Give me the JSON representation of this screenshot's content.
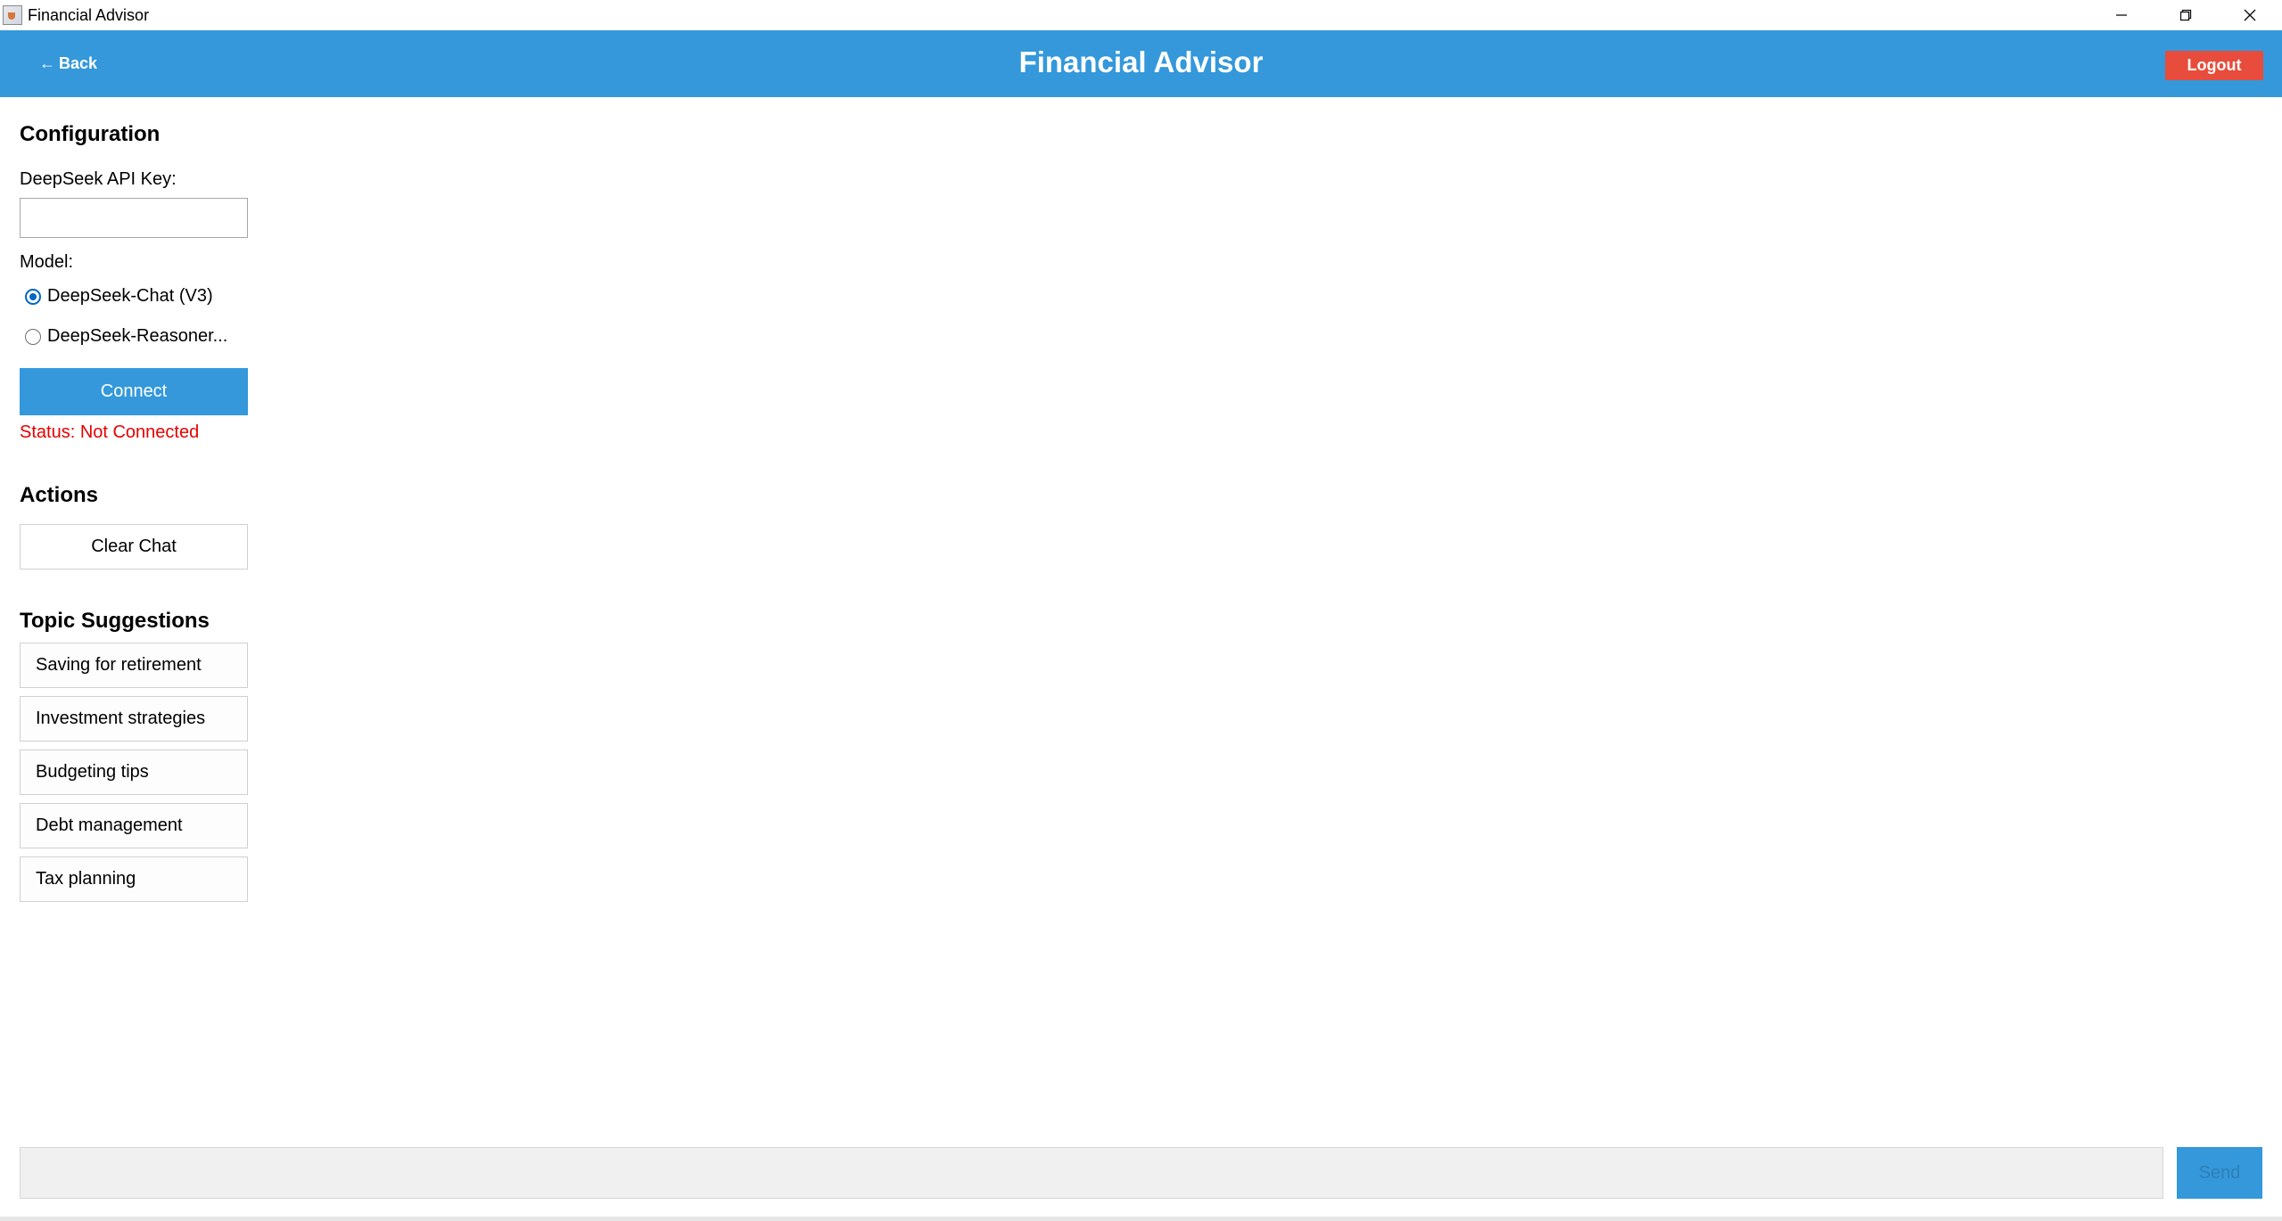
{
  "window": {
    "title": "Financial Advisor",
    "icon": "java-cup-icon"
  },
  "header": {
    "back_label": "Back",
    "title": "Financial Advisor",
    "logout_label": "Logout",
    "bg_color": "#3498db",
    "logout_color": "#e74c3c"
  },
  "sidebar": {
    "configuration": {
      "heading": "Configuration",
      "api_key_label": "DeepSeek API Key:",
      "api_key_value": "",
      "model_label": "Model:",
      "models": [
        {
          "label": "DeepSeek-Chat (V3)",
          "selected": true
        },
        {
          "label": "DeepSeek-Reasoner...",
          "selected": false
        }
      ],
      "connect_label": "Connect",
      "status": "Status: Not Connected",
      "status_color": "#e60000"
    },
    "actions": {
      "heading": "Actions",
      "clear_label": "Clear Chat"
    },
    "topics": {
      "heading": "Topic Suggestions",
      "items": [
        "Saving for retirement",
        "Investment strategies",
        "Budgeting tips",
        "Debt management",
        "Tax planning"
      ]
    }
  },
  "composer": {
    "input_value": "",
    "send_label": "Send"
  }
}
